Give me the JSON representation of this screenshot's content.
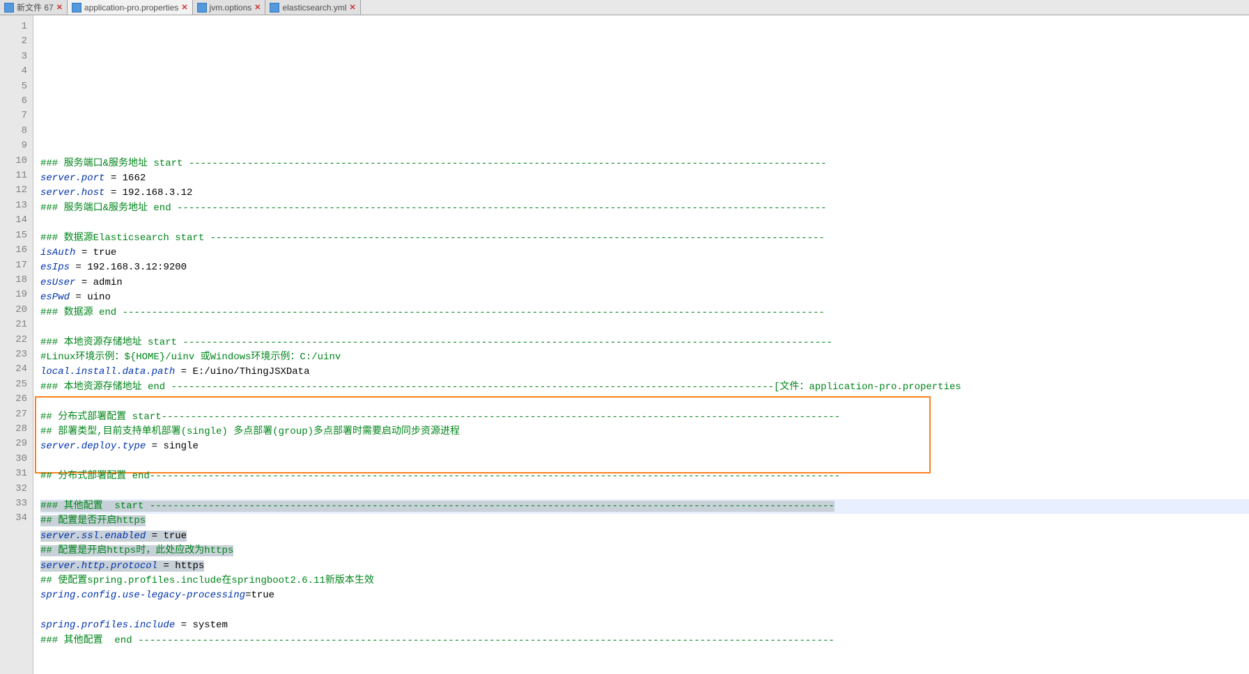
{
  "tabs": [
    {
      "label": "新文件 67",
      "active": false
    },
    {
      "label": "application-pro.properties",
      "active": true
    },
    {
      "label": "jvm.options",
      "active": false
    },
    {
      "label": "elasticsearch.yml",
      "active": false
    }
  ],
  "file_label": "[文件：application-pro.properties",
  "lines": [
    {
      "n": 1,
      "type": "comment",
      "text": "### 服务端口&服务地址 start -------------------------------------------------------------------------------------------------------------"
    },
    {
      "n": 2,
      "type": "kv",
      "key": "server.port",
      "eq": " = ",
      "val": "1662"
    },
    {
      "n": 3,
      "type": "kv",
      "key": "server.host",
      "eq": " = ",
      "val": "192.168.3.12"
    },
    {
      "n": 4,
      "type": "comment",
      "text": "### 服务端口&服务地址 end ---------------------------------------------------------------------------------------------------------------"
    },
    {
      "n": 5,
      "type": "blank",
      "text": ""
    },
    {
      "n": 6,
      "type": "comment",
      "text": "### 数据源Elasticsearch start ---------------------------------------------------------------------------------------------------------"
    },
    {
      "n": 7,
      "type": "kv",
      "key": "isAuth",
      "eq": " = ",
      "val": "true"
    },
    {
      "n": 8,
      "type": "kv",
      "key": "esIps",
      "eq": " = ",
      "val": "192.168.3.12:9200"
    },
    {
      "n": 9,
      "type": "kv",
      "key": "esUser",
      "eq": " = ",
      "val": "admin"
    },
    {
      "n": 10,
      "type": "kv",
      "key": "esPwd",
      "eq": " = ",
      "val": "uino"
    },
    {
      "n": 11,
      "type": "comment",
      "text": "### 数据源 end ------------------------------------------------------------------------------------------------------------------------"
    },
    {
      "n": 12,
      "type": "blank",
      "text": ""
    },
    {
      "n": 13,
      "type": "comment",
      "text": "### 本地资源存储地址 start ---------------------------------------------------------------------------------------------------------------"
    },
    {
      "n": 14,
      "type": "comment",
      "text": "#Linux环境示例：${HOME}/uinv 或Windows环境示例：C:/uinv"
    },
    {
      "n": 15,
      "type": "kv",
      "key": "local.install.data.path",
      "eq": " = ",
      "val": "E:/uino/ThingJSXData"
    },
    {
      "n": 16,
      "type": "comment",
      "text": "### 本地资源存储地址 end -------------------------------------------------------------------------------------------------------[文件：application-pro.properties"
    },
    {
      "n": 17,
      "type": "blank",
      "text": ""
    },
    {
      "n": 18,
      "type": "comment",
      "text": "## 分布式部署配置 start--------------------------------------------------------------------------------------------------------------------"
    },
    {
      "n": 19,
      "type": "comment",
      "text": "## 部署类型,目前支持单机部署(single) 多点部署(group)多点部署时需要启动同步资源进程"
    },
    {
      "n": 20,
      "type": "kv",
      "key": "server.deploy.type",
      "eq": " = ",
      "val": "single"
    },
    {
      "n": 21,
      "type": "blank",
      "text": ""
    },
    {
      "n": 22,
      "type": "comment",
      "text": "## 分布式部署配置 end----------------------------------------------------------------------------------------------------------------------"
    },
    {
      "n": 23,
      "type": "blank",
      "text": ""
    },
    {
      "n": 24,
      "type": "comment",
      "sel": true,
      "cur": true,
      "text": "### 其他配置  start ---------------------------------------------------------------------------------------------------------------------"
    },
    {
      "n": 25,
      "type": "comment",
      "sel": true,
      "text": "## 配置是否开启https"
    },
    {
      "n": 26,
      "type": "kv",
      "sel": true,
      "key": "server.ssl.enabled",
      "eq": " = ",
      "val": "true"
    },
    {
      "n": 27,
      "type": "comment",
      "sel": true,
      "text": "## 配置是开启https时，此处应改为https"
    },
    {
      "n": 28,
      "type": "kv",
      "sel": true,
      "key": "server.http.protocol",
      "eq": " = ",
      "val": "https"
    },
    {
      "n": 29,
      "type": "comment",
      "text": "## 使配置spring.profiles.include在springboot2.6.11新版本生效"
    },
    {
      "n": 30,
      "type": "kv",
      "key": "spring.config.use-legacy-processing",
      "eq": "=",
      "val": "true"
    },
    {
      "n": 31,
      "type": "blank",
      "text": ""
    },
    {
      "n": 32,
      "type": "kv",
      "key": "spring.profiles.include",
      "eq": " = ",
      "val": "system"
    },
    {
      "n": 33,
      "type": "comment",
      "text": "### 其他配置  end -----------------------------------------------------------------------------------------------------------------------"
    },
    {
      "n": 34,
      "type": "blank",
      "text": ""
    }
  ]
}
